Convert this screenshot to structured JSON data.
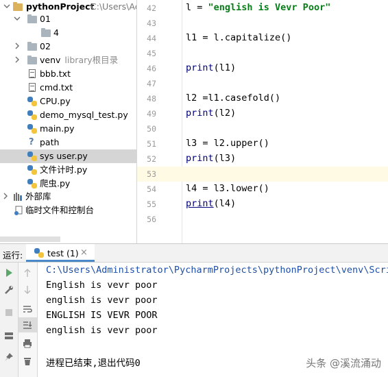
{
  "project_tree": {
    "root_name": "pythonProject",
    "root_path": "C:\\Users\\Ac",
    "items": [
      {
        "label": "01"
      },
      {
        "label": "4"
      },
      {
        "label": "02"
      },
      {
        "label": "venv",
        "hint": "library根目录"
      },
      {
        "label": "bbb.txt"
      },
      {
        "label": "cmd.txt"
      },
      {
        "label": "CPU.py"
      },
      {
        "label": "demo_mysql_test.py"
      },
      {
        "label": "main.py"
      },
      {
        "label": "path"
      },
      {
        "label": "sys user.py"
      },
      {
        "label": "文件计时.py"
      },
      {
        "label": "爬虫.py"
      },
      {
        "label": "外部库"
      },
      {
        "label": "临时文件和控制台"
      }
    ]
  },
  "editor": {
    "line_numbers": [
      "42",
      "43",
      "44",
      "45",
      "46",
      "47",
      "48",
      "49",
      "50",
      "51",
      "52",
      "53",
      "54",
      "55",
      "56"
    ],
    "lines": {
      "l42_a": "l = ",
      "l42_str": "\"english is Vevr Poor\"",
      "l44": "l1 = l.capitalize()",
      "l46_fn": "print",
      "l46_args": "(l1)",
      "l48": "l2 =l1.casefold()",
      "l49_fn": "print",
      "l49_args": "(l2)",
      "l51": "l3 = l2.upper()",
      "l52_fn": "print",
      "l52_args": "(l3)",
      "l54": "l4 = l3.lower()",
      "l55_fn": "print",
      "l55_args": "(l4)"
    }
  },
  "run_panel": {
    "label": "运行:",
    "tab_name": "test (1)",
    "close_glyph": "×",
    "output": [
      "C:\\Users\\Administrator\\PycharmProjects\\pythonProject\\venv\\Scrip",
      "English is vevr poor",
      "english is vevr poor",
      "ENGLISH IS VEVR POOR",
      "english is vevr poor",
      "",
      "进程已结束,退出代码0"
    ]
  },
  "watermark": "头条 @溪流涌动",
  "colors": {
    "string": "#067d17",
    "builtin": "#000080",
    "current_line": "#fffae3",
    "selected_row": "#d5d5d5",
    "tab_accent": "#4a88c7",
    "run_green": "#59a869"
  }
}
